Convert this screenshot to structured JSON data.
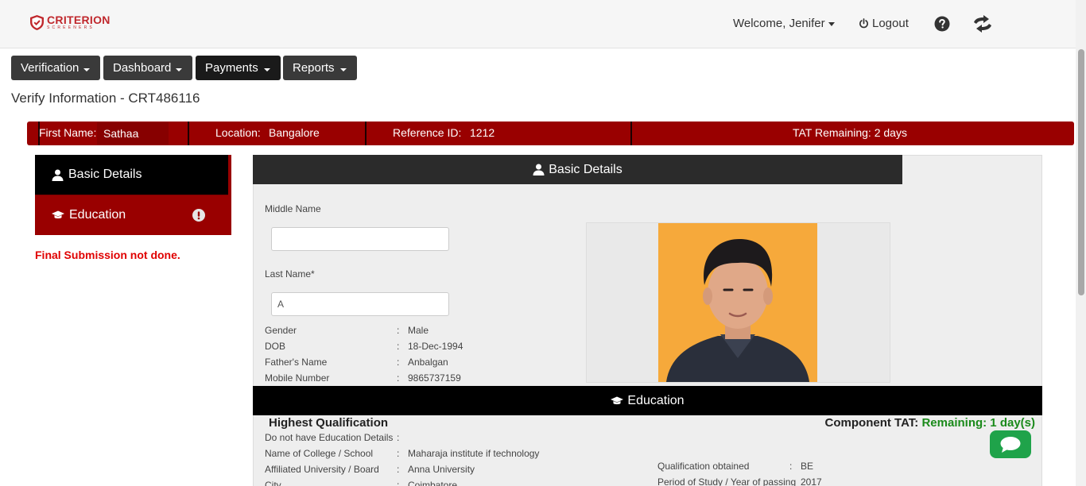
{
  "header": {
    "logo_text": "CRITERION",
    "logo_subtext": "SCREENERS",
    "welcome": "Welcome, Jenifer",
    "logout": "Logout",
    "help_icon": "question-circle-icon",
    "swap_icon": "swap-arrows-icon"
  },
  "nav": [
    {
      "label": "Verification"
    },
    {
      "label": "Dashboard"
    },
    {
      "label": "Payments"
    },
    {
      "label": "Reports"
    }
  ],
  "page_title": "Verify Information - CRT486116",
  "infobar": {
    "first_name_label": "First Name:",
    "first_name_value": "Sathaa",
    "location_label": "Location:",
    "location_value": "Bangalore",
    "reference_label": "Reference ID:",
    "reference_value": "1212",
    "tat": "TAT Remaining: 2 days"
  },
  "sidetabs": [
    {
      "label": "Basic Details",
      "icon": "user-icon"
    },
    {
      "label": "Education",
      "icon": "graduation-cap-icon",
      "status_icon": "exclamation-circle-icon"
    }
  ],
  "final_submission": "Final Submission not done.",
  "basic_details": {
    "heading": "Basic Details",
    "middle_name_label": "Middle Name",
    "middle_name_value": "",
    "last_name_label": "Last Name*",
    "last_name_value": "A",
    "fields": [
      {
        "label": "Gender",
        "value": "Male"
      },
      {
        "label": "DOB",
        "value": "18-Dec-1994"
      },
      {
        "label": "Father's Name",
        "value": "Anbalgan"
      },
      {
        "label": "Mobile Number",
        "value": "9865737159"
      }
    ]
  },
  "education": {
    "heading": "Education",
    "highest_qualification": "Highest Qualification",
    "component_tat_label": "Component TAT:",
    "component_tat_value": "Remaining: 1 day(s)",
    "left_fields": [
      {
        "label": "Do not have Education Details",
        "value": ""
      },
      {
        "label": "Name of College / School",
        "value": "Maharaja institute if technology"
      },
      {
        "label": "Affiliated University / Board",
        "value": "Anna University"
      },
      {
        "label": "City",
        "value": "Coimbatore"
      }
    ],
    "right_fields": [
      {
        "label": "Qualification obtained",
        "value": "BE"
      },
      {
        "label": "Period of Study / Year of passing",
        "value": "2017"
      }
    ]
  },
  "colors": {
    "brand_red": "#990000",
    "status_green": "#1a8a1a",
    "chat_green": "#1fa34a"
  },
  "chat_icon": "chat-bubble-icon"
}
